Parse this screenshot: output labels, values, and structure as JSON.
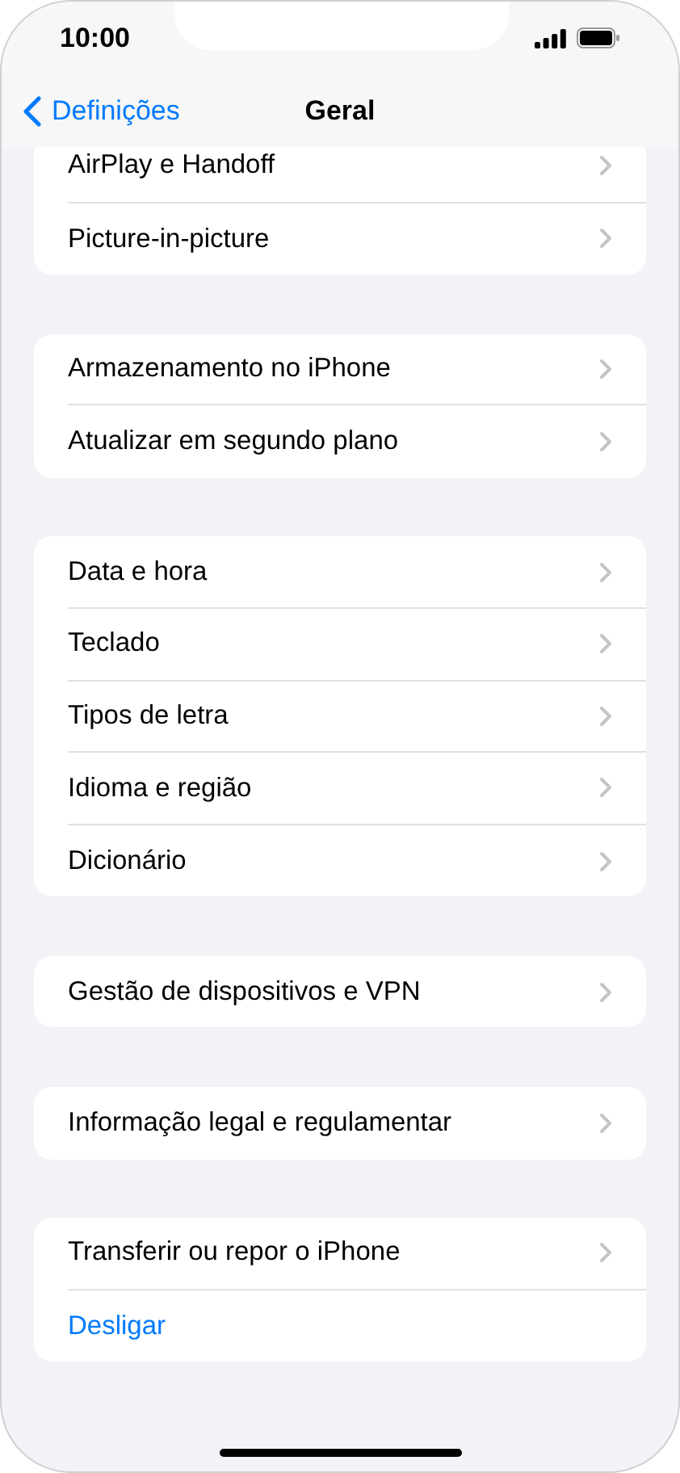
{
  "status_bar": {
    "time": "10:00"
  },
  "nav": {
    "back_label": "Definições",
    "title": "Geral"
  },
  "groups": [
    {
      "rows": [
        {
          "label": "AirPlay e Handoff",
          "kind": "link"
        },
        {
          "label": "Picture-in-picture",
          "kind": "link"
        }
      ]
    },
    {
      "rows": [
        {
          "label": "Armazenamento no iPhone",
          "kind": "link"
        },
        {
          "label": "Atualizar em segundo plano",
          "kind": "link"
        }
      ]
    },
    {
      "rows": [
        {
          "label": "Data e hora",
          "kind": "link"
        },
        {
          "label": "Teclado",
          "kind": "link"
        },
        {
          "label": "Tipos de letra",
          "kind": "link"
        },
        {
          "label": "Idioma e região",
          "kind": "link"
        },
        {
          "label": "Dicionário",
          "kind": "link"
        }
      ]
    },
    {
      "rows": [
        {
          "label": "Gestão de dispositivos e VPN",
          "kind": "link"
        }
      ]
    },
    {
      "rows": [
        {
          "label": "Informação legal e regulamentar",
          "kind": "link"
        }
      ]
    },
    {
      "rows": [
        {
          "label": "Transferir ou repor o iPhone",
          "kind": "link"
        },
        {
          "label": "Desligar",
          "kind": "action"
        }
      ]
    }
  ]
}
